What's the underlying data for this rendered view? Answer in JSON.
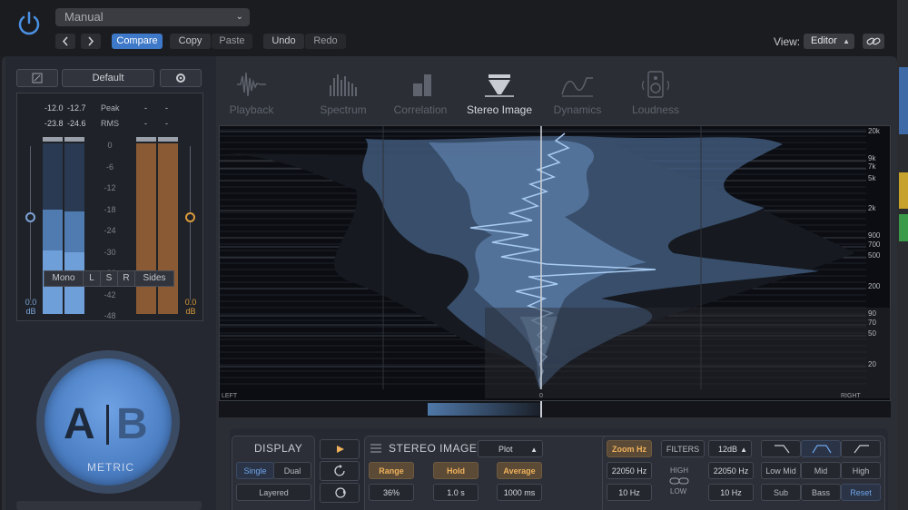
{
  "header": {
    "preset": "Manual",
    "compare": "Compare",
    "copy": "Copy",
    "paste": "Paste",
    "undo": "Undo",
    "redo": "Redo",
    "view_label": "View:",
    "view_value": "Editor"
  },
  "meter": {
    "preset_name": "Default",
    "peak_l": "-12.0",
    "peak_r": "-12.7",
    "peak_label": "Peak",
    "peak_b1": "-",
    "peak_b2": "-",
    "rms_l": "-23.8",
    "rms_r": "-24.6",
    "rms_label": "RMS",
    "rms_b1": "-",
    "rms_b2": "-",
    "scale": [
      "0",
      "-6",
      "-12",
      "-18",
      "-24",
      "-30",
      "-36",
      "-42",
      "-48"
    ],
    "left_gain_value": "0.0",
    "left_gain_unit": "dB",
    "right_gain_value": "0.0",
    "right_gain_unit": "dB",
    "channel_modes": [
      "Mono",
      "L",
      "S",
      "R",
      "Sides"
    ]
  },
  "ab": {
    "a": "A",
    "b": "B",
    "brand": "METRIC"
  },
  "tabs": [
    {
      "label": "Playback"
    },
    {
      "label": "Spectrum"
    },
    {
      "label": "Correlation"
    },
    {
      "label": "Stereo Image",
      "active": true
    },
    {
      "label": "Dynamics"
    },
    {
      "label": "Loudness"
    }
  ],
  "viz": {
    "hz_labels": [
      "20k",
      "9k",
      "7k",
      "5k",
      "2k",
      "900",
      "700",
      "500",
      "200",
      "90",
      "70",
      "50",
      "20"
    ],
    "left": "LEFT",
    "center": "0",
    "right": "RIGHT"
  },
  "controls": {
    "display_title": "DISPLAY",
    "single": "Single",
    "dual": "Dual",
    "layered": "Layered",
    "stereo_title": "STEREO IMAGE",
    "plot_mode": "Plot",
    "range_label": "Range",
    "range_value": "36%",
    "hold_label": "Hold",
    "hold_value": "1.0 s",
    "average_label": "Average",
    "average_value": "1000 ms",
    "zoom_hz": "Zoom Hz",
    "filters": "FILTERS",
    "slope": "12dB",
    "high_freq_l": "22050 Hz",
    "low_freq_l": "10 Hz",
    "high": "HIGH",
    "low": "LOW",
    "high_freq_r": "22050 Hz",
    "low_freq_r": "10 Hz",
    "bands": [
      "Low Mid",
      "Mid",
      "High",
      "Sub",
      "Bass",
      "Reset"
    ]
  },
  "colors": {
    "accent_blue": "#3e78c8",
    "orange": "#f1b25b",
    "meter_blue": "#6f9fd8",
    "meter_brown": "#8a5a35"
  }
}
